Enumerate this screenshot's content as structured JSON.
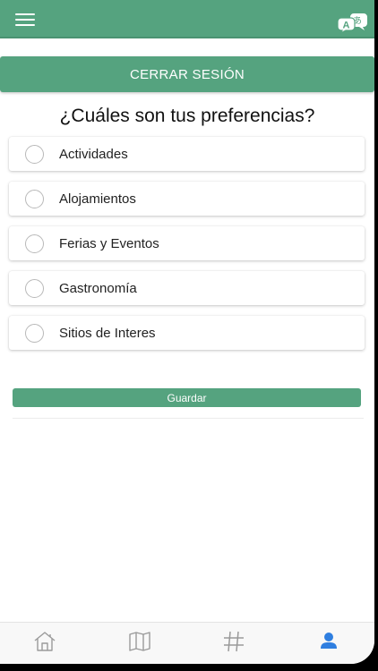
{
  "header": {
    "menu_icon": "hamburger-menu-icon",
    "translate_icon": "translate-icon",
    "translate_glyph_latin": "A",
    "translate_glyph_kana": "あ"
  },
  "logout": {
    "label": "CERRAR SESIÓN"
  },
  "title": "¿Cuáles son tus preferencias?",
  "preferences": [
    {
      "label": "Actividades",
      "selected": false
    },
    {
      "label": "Alojamientos",
      "selected": false
    },
    {
      "label": "Ferias y Eventos",
      "selected": false
    },
    {
      "label": "Gastronomía",
      "selected": false
    },
    {
      "label": "Sitios de Interes",
      "selected": false
    }
  ],
  "save": {
    "label": "Guardar"
  },
  "tabbar": {
    "tabs": [
      {
        "icon": "home-icon",
        "active": false
      },
      {
        "icon": "map-icon",
        "active": false
      },
      {
        "icon": "hashtag-icon",
        "active": false
      },
      {
        "icon": "user-icon",
        "active": true
      }
    ]
  },
  "colors": {
    "primary": "#55a37f",
    "active_tab": "#2f7fe0",
    "inactive_tab": "#9a9a9a"
  }
}
